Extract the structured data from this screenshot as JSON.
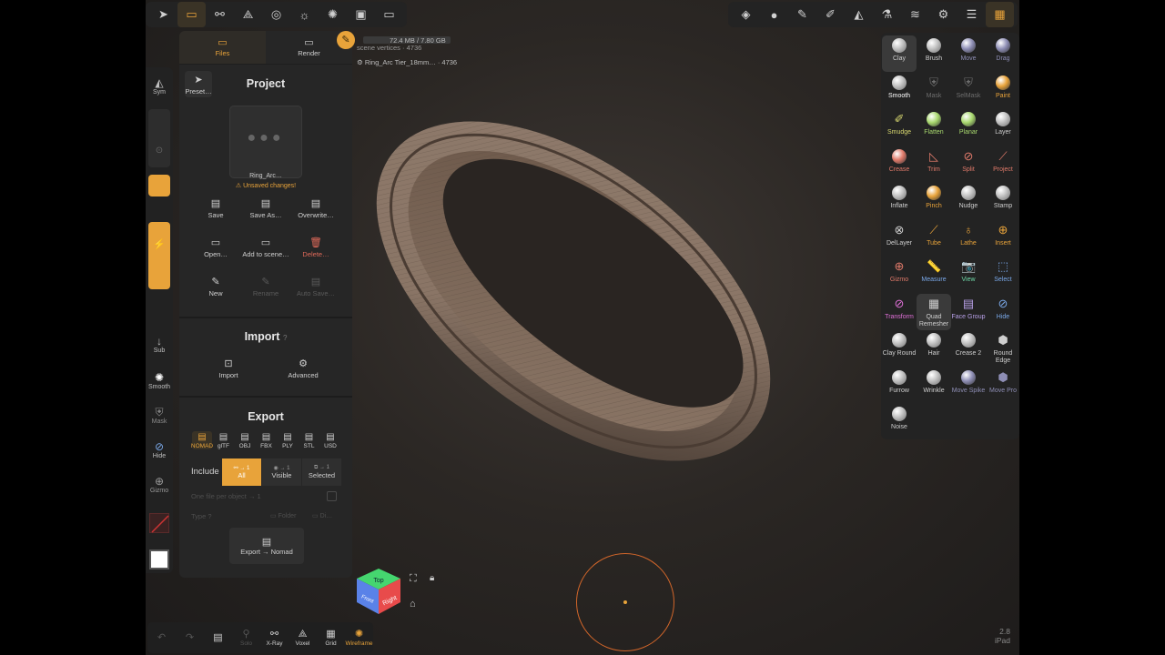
{
  "topbar_left": [
    {
      "name": "nomad-menu",
      "icon": "nomad-logo-icon",
      "glyph": "➤",
      "active": false
    },
    {
      "name": "files",
      "icon": "folder-icon",
      "glyph": "▭",
      "active": true
    },
    {
      "name": "scene",
      "icon": "scene-graph-icon",
      "glyph": "⚯",
      "active": false
    },
    {
      "name": "topology",
      "icon": "topology-icon",
      "glyph": "⟁",
      "active": false
    },
    {
      "name": "material",
      "icon": "material-icon",
      "glyph": "◎",
      "active": false
    },
    {
      "name": "light",
      "icon": "sun-icon",
      "glyph": "☼",
      "active": false
    },
    {
      "name": "postprocess",
      "icon": "postprocess-icon",
      "glyph": "✺",
      "active": false
    },
    {
      "name": "background",
      "icon": "image-icon",
      "glyph": "▣",
      "active": false
    },
    {
      "name": "camera",
      "icon": "camera-icon",
      "glyph": "▭",
      "active": false
    }
  ],
  "topbar_right": [
    {
      "name": "layers-stack",
      "icon": "stack-icon",
      "glyph": "◈",
      "active": false
    },
    {
      "name": "matcap",
      "icon": "sphere-icon",
      "glyph": "●",
      "active": false
    },
    {
      "name": "stroke",
      "icon": "brush-icon",
      "glyph": "✎",
      "active": false
    },
    {
      "name": "painting",
      "icon": "paint-icon",
      "glyph": "✐",
      "active": false
    },
    {
      "name": "symmetry",
      "icon": "symmetry-icon",
      "glyph": "◭",
      "active": false
    },
    {
      "name": "flask",
      "icon": "flask-icon",
      "glyph": "⚗",
      "active": false
    },
    {
      "name": "layers",
      "icon": "layers-icon",
      "glyph": "≋",
      "active": false
    },
    {
      "name": "settings",
      "icon": "gear-icon",
      "glyph": "⚙",
      "active": false
    },
    {
      "name": "sliders",
      "icon": "sliders-icon",
      "glyph": "☰",
      "active": false
    },
    {
      "name": "tools",
      "icon": "tools-grid-icon",
      "glyph": "▦",
      "active": true
    }
  ],
  "info": {
    "memory": "72.4 MB / 7.80 GB",
    "scene_vertices": "scene vertices · 4736",
    "object": "Ring_Arc Tier_18mm… · 4736"
  },
  "left_toolbar": {
    "sym": "Sym",
    "sub": "Sub",
    "smooth": "Smooth",
    "mask": "Mask",
    "hide": "Hide",
    "gizmo": "Gizmo"
  },
  "panel": {
    "tabs": [
      {
        "label": "Files",
        "icon": "folder-icon"
      },
      {
        "label": "Render",
        "icon": "monitor-icon"
      }
    ],
    "preset": "Preset…",
    "project_title": "Project",
    "thumbnail_name": "Ring_Arc…",
    "unsaved": "⚠ Unsaved changes!",
    "buttons": [
      {
        "label": "Save",
        "icon": "save-icon",
        "glyph": "▤",
        "state": ""
      },
      {
        "label": "Save As…",
        "icon": "save-as-icon",
        "glyph": "▤",
        "state": ""
      },
      {
        "label": "Overwrite…",
        "icon": "overwrite-icon",
        "glyph": "▤",
        "state": ""
      },
      {
        "label": "Open…",
        "icon": "folder-open-icon",
        "glyph": "▭",
        "state": ""
      },
      {
        "label": "Add to scene…",
        "icon": "folder-add-icon",
        "glyph": "▭",
        "state": ""
      },
      {
        "label": "Delete…",
        "icon": "trash-icon",
        "glyph": "🗑",
        "state": "del"
      },
      {
        "label": "New",
        "icon": "new-file-icon",
        "glyph": "✎",
        "state": ""
      },
      {
        "label": "Rename",
        "icon": "rename-icon",
        "glyph": "✎",
        "state": "dis"
      },
      {
        "label": "Auto Save…",
        "icon": "auto-save-icon",
        "glyph": "▤",
        "state": "dis"
      }
    ],
    "import_title": "Import",
    "import_help": "?",
    "import_buttons": [
      {
        "label": "Import",
        "icon": "import-icon",
        "glyph": "⊡"
      },
      {
        "label": "Advanced",
        "icon": "gear-icon",
        "glyph": "⚙"
      }
    ],
    "export_title": "Export",
    "formats": [
      "NOMAD",
      "glTF",
      "OBJ",
      "FBX",
      "PLY",
      "STL",
      "USD"
    ],
    "include_label": "Include",
    "include": [
      {
        "label": "All",
        "sub": "⚯ → 1",
        "active": true
      },
      {
        "label": "Visible",
        "sub": "◉ → 1",
        "active": false
      },
      {
        "label": "Selected",
        "sub": "⧉ → 1",
        "active": false
      }
    ],
    "one_file": "One file per object → 1",
    "type": "Type",
    "type_help": "?",
    "folder": "Folder",
    "dir": "Di…",
    "export_button": "Export → Nomad"
  },
  "tools": [
    {
      "label": "Clay",
      "kind": "sphere",
      "color": "#cfcfcf",
      "active": true
    },
    {
      "label": "Brush",
      "kind": "sphere",
      "color": "#cfcfcf"
    },
    {
      "label": "Move",
      "kind": "sphere",
      "color": "#8e8eb5"
    },
    {
      "label": "Drag",
      "kind": "sphere",
      "color": "#8e8eb5"
    },
    {
      "label": "Smooth",
      "kind": "sphere",
      "color": "#ffffff"
    },
    {
      "label": "Mask",
      "kind": "glyph",
      "glyph": "⛨",
      "color": "#6e6e6e"
    },
    {
      "label": "SelMask",
      "kind": "glyph",
      "glyph": "⛨",
      "color": "#6e6e6e"
    },
    {
      "label": "Paint",
      "kind": "sphere",
      "color": "#e8a33a"
    },
    {
      "label": "Smudge",
      "kind": "glyph",
      "glyph": "✐",
      "color": "#d8d870"
    },
    {
      "label": "Flatten",
      "kind": "sphere",
      "color": "#a8d86e"
    },
    {
      "label": "Planar",
      "kind": "sphere",
      "color": "#a8d86e"
    },
    {
      "label": "Layer",
      "kind": "sphere",
      "color": "#cfcfcf"
    },
    {
      "label": "Crease",
      "kind": "sphere",
      "color": "#e07a6a"
    },
    {
      "label": "Trim",
      "kind": "glyph",
      "glyph": "◺",
      "color": "#e07a6a"
    },
    {
      "label": "Split",
      "kind": "glyph",
      "glyph": "⊘",
      "color": "#e07a6a"
    },
    {
      "label": "Project",
      "kind": "glyph",
      "glyph": "⟋",
      "color": "#e07a6a"
    },
    {
      "label": "Inflate",
      "kind": "sphere",
      "color": "#cfcfcf"
    },
    {
      "label": "Pinch",
      "kind": "sphere",
      "color": "#e8a33a"
    },
    {
      "label": "Nudge",
      "kind": "sphere",
      "color": "#cfcfcf"
    },
    {
      "label": "Stamp",
      "kind": "sphere",
      "color": "#cfcfcf"
    },
    {
      "label": "DelLayer",
      "kind": "glyph",
      "glyph": "⊗",
      "color": "#cfcfcf"
    },
    {
      "label": "Tube",
      "kind": "glyph",
      "glyph": "⟋",
      "color": "#e8a33a"
    },
    {
      "label": "Lathe",
      "kind": "glyph",
      "glyph": "♁",
      "color": "#e8a33a"
    },
    {
      "label": "Insert",
      "kind": "glyph",
      "glyph": "⊕",
      "color": "#e8a33a"
    },
    {
      "label": "Gizmo",
      "kind": "glyph",
      "glyph": "⊕",
      "color": "#e07a6a"
    },
    {
      "label": "Measure",
      "kind": "glyph",
      "glyph": "📏",
      "color": "#7aa8e8"
    },
    {
      "label": "View",
      "kind": "glyph",
      "glyph": "📷",
      "color": "#6ed8a8"
    },
    {
      "label": "Select",
      "kind": "glyph",
      "glyph": "⬚",
      "color": "#7aa8e8"
    },
    {
      "label": "Transform",
      "kind": "glyph",
      "glyph": "⊘",
      "color": "#e070d8"
    },
    {
      "label": "Quad Remesher",
      "kind": "glyph",
      "glyph": "▦",
      "color": "#cfcfcf",
      "active": true
    },
    {
      "label": "Face Group",
      "kind": "glyph",
      "glyph": "▤",
      "color": "#b8a0e8"
    },
    {
      "label": "Hide",
      "kind": "glyph",
      "glyph": "⊘",
      "color": "#7aa8e8"
    },
    {
      "label": "Clay Round",
      "kind": "sphere",
      "color": "#cfcfcf"
    },
    {
      "label": "Hair",
      "kind": "sphere",
      "color": "#cfcfcf"
    },
    {
      "label": "Crease 2",
      "kind": "sphere",
      "color": "#cfcfcf"
    },
    {
      "label": "Round Edge",
      "kind": "glyph",
      "glyph": "⬢",
      "color": "#cfcfcf"
    },
    {
      "label": "Furrow",
      "kind": "sphere",
      "color": "#cfcfcf"
    },
    {
      "label": "Wrinkle",
      "kind": "sphere",
      "color": "#cfcfcf"
    },
    {
      "label": "Move Spike",
      "kind": "sphere",
      "color": "#8e8eb5"
    },
    {
      "label": "Move Pro",
      "kind": "glyph",
      "glyph": "⬢",
      "color": "#8e8eb5"
    },
    {
      "label": "Noise",
      "kind": "sphere",
      "color": "#cfcfcf"
    }
  ],
  "viewcube": {
    "top": "Top",
    "right": "Right",
    "front": "Front"
  },
  "bottom_bar": [
    {
      "label": "",
      "icon": "undo-icon",
      "glyph": "↶",
      "state": "dis"
    },
    {
      "label": "",
      "icon": "redo-icon",
      "glyph": "↷",
      "state": "dis"
    },
    {
      "label": "",
      "icon": "clipboard-icon",
      "glyph": "▤",
      "state": ""
    },
    {
      "label": "Solo",
      "icon": "solo-icon",
      "glyph": "⚲",
      "state": "dis"
    },
    {
      "label": "X-Ray",
      "icon": "xray-icon",
      "glyph": "⚯",
      "state": ""
    },
    {
      "label": "Voxel",
      "icon": "voxel-icon",
      "glyph": "⟁",
      "state": ""
    },
    {
      "label": "Grid",
      "icon": "grid-icon",
      "glyph": "▦",
      "state": ""
    },
    {
      "label": "Wireframe",
      "icon": "wireframe-icon",
      "glyph": "✺",
      "state": "active"
    }
  ],
  "version": {
    "number": "2.8",
    "device": "iPad"
  },
  "colors": {
    "accent": "#e8a33a",
    "panel": "#262626",
    "ring": "#8a7566",
    "brush_cursor": "#d2662a"
  }
}
